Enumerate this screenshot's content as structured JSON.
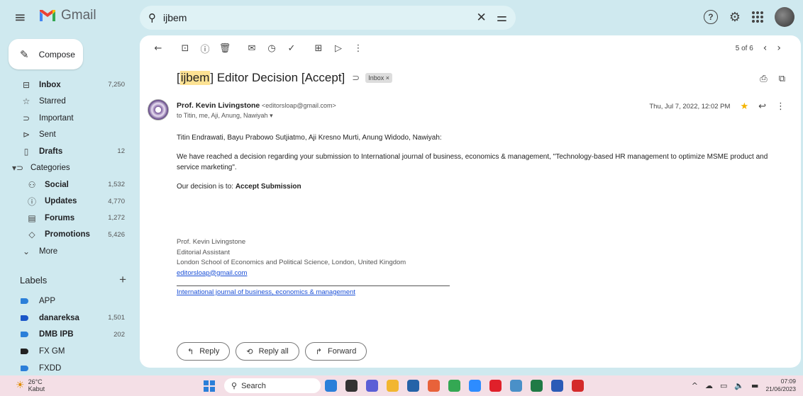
{
  "app": {
    "name": "Gmail"
  },
  "search": {
    "value": "ijbem"
  },
  "compose_label": "Compose",
  "nav": [
    {
      "icon": "inbox-icon",
      "glyph": "⊟",
      "label": "Inbox",
      "count": "7,250",
      "bold": true
    },
    {
      "icon": "star-icon",
      "glyph": "☆",
      "label": "Starred",
      "count": "",
      "bold": false
    },
    {
      "icon": "important-icon",
      "glyph": "⊃",
      "label": "Important",
      "count": "",
      "bold": false
    },
    {
      "icon": "send-icon",
      "glyph": "⊳",
      "label": "Sent",
      "count": "",
      "bold": false
    },
    {
      "icon": "draft-icon",
      "glyph": "▯",
      "label": "Drafts",
      "count": "12",
      "bold": true
    },
    {
      "icon": "label-icon",
      "glyph": "▾⊃",
      "label": "Categories",
      "count": "",
      "bold": false,
      "cat": true
    },
    {
      "icon": "social-icon",
      "glyph": "⚇",
      "label": "Social",
      "count": "1,532",
      "bold": true,
      "sub": true
    },
    {
      "icon": "info-icon",
      "glyph": "ⓘ",
      "label": "Updates",
      "count": "4,770",
      "bold": true,
      "sub": true
    },
    {
      "icon": "forum-icon",
      "glyph": "▤",
      "label": "Forums",
      "count": "1,272",
      "bold": true,
      "sub": true
    },
    {
      "icon": "tag-icon",
      "glyph": "◇",
      "label": "Promotions",
      "count": "5,426",
      "bold": true,
      "sub": true
    },
    {
      "icon": "chevron-down-icon",
      "glyph": "⌄",
      "label": "More",
      "count": "",
      "bold": false
    }
  ],
  "labels_title": "Labels",
  "labels": [
    {
      "name": "APP",
      "count": "",
      "color": "#2b7fd9",
      "bold": false
    },
    {
      "name": "danareksa",
      "count": "1,501",
      "color": "#1a56c8",
      "bold": true
    },
    {
      "name": "DMB IPB",
      "count": "202",
      "color": "#2b7fd9",
      "bold": true
    },
    {
      "name": "FX GM",
      "count": "",
      "color": "#222222",
      "bold": false
    },
    {
      "name": "FXDD",
      "count": "",
      "color": "#2b7fd9",
      "bold": false
    }
  ],
  "pager": {
    "text": "5 of 6"
  },
  "email": {
    "subject_highlight": "ijbem",
    "subject_rest": "Editor Decision [Accept]",
    "inbox_chip": "Inbox ×",
    "sender_name": "Prof. Kevin Livingstone",
    "sender_email": "<editorsloap@gmail.com>",
    "recipients": "to Titin, me, Aji, Anung, Nawiyah ▾",
    "date": "Thu, Jul 7, 2022, 12:02 PM",
    "greeting": "Titin Endrawati, Bayu Prabowo Sutjiatmo, Aji Kresno Murti, Anung Widodo, Nawiyah:",
    "para1": "We have reached a decision regarding your submission to International journal of business, economics & management, \"Technology-based HR management to optimize MSME product and service marketing\".",
    "decision_prefix": "Our decision is to: ",
    "decision": "Accept Submission",
    "sig_name": "Prof. Kevin Livingstone",
    "sig_role": "Editorial Assistant",
    "sig_org": "London School of Economics and Political Science, London, United Kingdom",
    "sig_email": "editorsloap@gmail.com",
    "journal_link": "International journal of business, economics & management"
  },
  "actions": {
    "reply": "Reply",
    "reply_all": "Reply all",
    "forward": "Forward"
  },
  "taskbar": {
    "temp": "26°C",
    "weather": "Kabut",
    "search": "Search",
    "time": "07:09",
    "date": "21/06/2023"
  },
  "taskbar_apps": [
    {
      "name": "bing-app-icon",
      "color": "#2b7fd9"
    },
    {
      "name": "terminal-app-icon",
      "color": "#333333"
    },
    {
      "name": "chat-app-icon",
      "color": "#5b5fd6"
    },
    {
      "name": "folder-app-icon",
      "color": "#f2b630"
    },
    {
      "name": "store-app-icon",
      "color": "#2563a8"
    },
    {
      "name": "browser-app-icon",
      "color": "#e8623a"
    },
    {
      "name": "chrome-app-icon",
      "color": "#34a853"
    },
    {
      "name": "zoom-app-icon",
      "color": "#2d8cff"
    },
    {
      "name": "opera-app-icon",
      "color": "#e0202a"
    },
    {
      "name": "notepad-app-icon",
      "color": "#4a90c8"
    },
    {
      "name": "excel-app-icon",
      "color": "#1f7a45"
    },
    {
      "name": "word-app-icon",
      "color": "#2b5bb7"
    },
    {
      "name": "pdf-app-icon",
      "color": "#d42a2a"
    }
  ],
  "colors": {
    "background": "#cfe9ef",
    "panel": "#ffffff",
    "highlight": "#fde293",
    "star": "#f4b400",
    "link": "#1a4fd6"
  }
}
